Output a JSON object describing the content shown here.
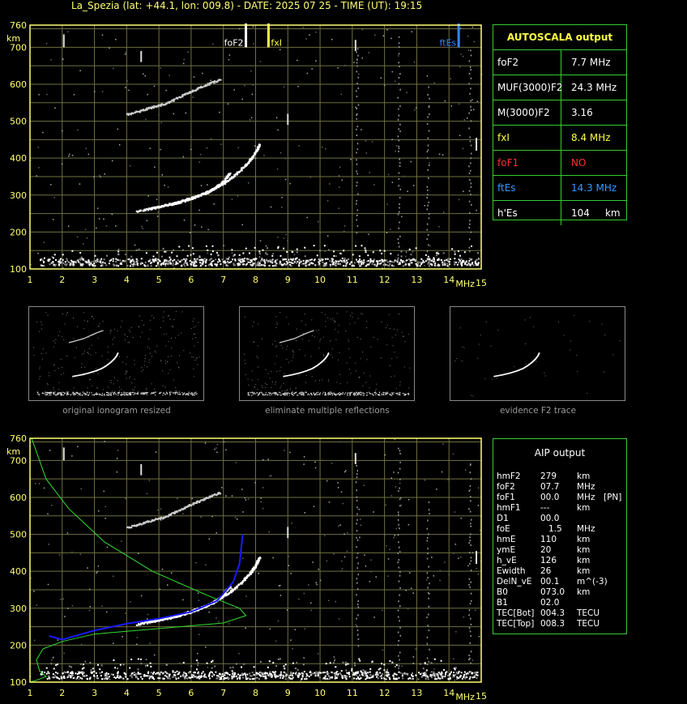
{
  "header": {
    "title": "La_Spezia (lat: +44.1, lon: 009.8) - DATE: 2025 07 25 - TIME (UT): 19:15"
  },
  "colors": {
    "axis": "#ffff70",
    "grid": "#6f6f40",
    "panel_border": "#33cc33",
    "foF2_marker": "#ffffff",
    "fxI_marker": "#ffff40",
    "ftEs_marker": "#3388ff",
    "red_text": "#ff3030",
    "blue_text": "#3399ff",
    "profile_green": "#33dd33",
    "profile_blue": "#1a1aff"
  },
  "chart_data": [
    {
      "type": "scatter",
      "name_id": "autoscala-ionogram",
      "xlabel": "MHz",
      "ylabel": "km",
      "xlim": [
        1,
        15
      ],
      "ylim": [
        100,
        760
      ],
      "xticks": [
        1,
        2,
        3,
        4,
        5,
        6,
        7,
        8,
        9,
        10,
        11,
        12,
        13,
        14,
        15
      ],
      "yticks": [
        100,
        200,
        300,
        400,
        500,
        600,
        700,
        760
      ],
      "grid": true,
      "markers": [
        {
          "label": "foF2",
          "x": 7.7,
          "color": "#ffffff"
        },
        {
          "label": "fxI",
          "x": 8.4,
          "color": "#ffff40"
        },
        {
          "label": "ftEs",
          "x": 14.3,
          "color": "#3388ff"
        }
      ],
      "traces": [
        {
          "name": "o-trace",
          "points": [
            [
              4.3,
              258
            ],
            [
              5.0,
              270
            ],
            [
              5.6,
              283
            ],
            [
              6.2,
              300
            ],
            [
              6.7,
              318
            ],
            [
              7.1,
              340
            ],
            [
              7.5,
              368
            ],
            [
              7.8,
              395
            ],
            [
              8.0,
              420
            ],
            [
              8.1,
              440
            ]
          ]
        },
        {
          "name": "x-trace",
          "points": [
            [
              4.7,
              265
            ],
            [
              5.4,
              277
            ],
            [
              6.0,
              292
            ],
            [
              6.5,
              310
            ],
            [
              6.9,
              332
            ],
            [
              7.2,
              362
            ]
          ]
        },
        {
          "name": "multiple-reflection",
          "points": [
            [
              4.0,
              520
            ],
            [
              4.6,
              535
            ],
            [
              5.2,
              550
            ],
            [
              5.8,
              575
            ],
            [
              6.3,
              595
            ],
            [
              6.9,
              615
            ]
          ]
        },
        {
          "name": "Es-layer",
          "points": [
            [
              1.3,
              120
            ],
            [
              3,
              122
            ],
            [
              5,
              120
            ],
            [
              7,
              121
            ],
            [
              9,
              121
            ],
            [
              11,
              122
            ],
            [
              12,
              120
            ],
            [
              14,
              125
            ],
            [
              14.9,
              123
            ]
          ]
        }
      ]
    },
    {
      "type": "scatter",
      "name_id": "aip-ionogram",
      "xlabel": "MHz",
      "ylabel": "km",
      "xlim": [
        1,
        15
      ],
      "ylim": [
        100,
        760
      ],
      "xticks": [
        1,
        2,
        3,
        4,
        5,
        6,
        7,
        8,
        9,
        10,
        11,
        12,
        13,
        14,
        15
      ],
      "yticks": [
        100,
        200,
        300,
        400,
        500,
        600,
        700,
        760
      ],
      "grid": true,
      "profiles": [
        {
          "name": "green-profile",
          "color": "#33dd33",
          "points": [
            [
              1.05,
              760
            ],
            [
              1.5,
              650
            ],
            [
              2.2,
              570
            ],
            [
              3.3,
              480
            ],
            [
              4.8,
              400
            ],
            [
              6.5,
              335
            ],
            [
              7.5,
              300
            ],
            [
              7.7,
              280
            ],
            [
              7.0,
              260
            ],
            [
              5.0,
              245
            ],
            [
              3.0,
              230
            ],
            [
              2.0,
              210
            ],
            [
              1.4,
              190
            ],
            [
              1.2,
              160
            ],
            [
              1.3,
              130
            ],
            [
              1.5,
              115
            ],
            [
              1.2,
              105
            ],
            [
              1.0,
              100
            ]
          ]
        },
        {
          "name": "blue-trace",
          "color": "#1a1aff",
          "points": [
            [
              1.6,
              225
            ],
            [
              2.0,
              215
            ],
            [
              3.0,
              240
            ],
            [
              4.0,
              258
            ],
            [
              5.0,
              272
            ],
            [
              6.0,
              290
            ],
            [
              6.8,
              320
            ],
            [
              7.3,
              370
            ],
            [
              7.5,
              420
            ],
            [
              7.6,
              500
            ]
          ]
        }
      ]
    }
  ],
  "autoscala": {
    "title": "AUTOSCALA output",
    "rows": [
      {
        "key": "foF2",
        "value": "7.7 MHz",
        "color": "#ffffff"
      },
      {
        "key": "MUF(3000)F2",
        "value": "24.3 MHz",
        "color": "#ffffff"
      },
      {
        "key": "M(3000)F2",
        "value": "3.16",
        "color": "#ffffff"
      },
      {
        "key": "fxI",
        "value": "8.4 MHz",
        "color": "#ffff40"
      },
      {
        "key": "foF1",
        "value": "NO",
        "color": "#ff3030"
      },
      {
        "key": "ftEs",
        "value": "14.3 MHz",
        "color": "#3399ff"
      },
      {
        "key": "h'Es",
        "value": "104     km",
        "color": "#ffffff"
      }
    ]
  },
  "thumbs": [
    {
      "caption": "original ionogram resized"
    },
    {
      "caption": "eliminate multiple reflections"
    },
    {
      "caption": "evidence F2 trace"
    }
  ],
  "aip": {
    "title": "AIP output",
    "rows": [
      {
        "key": "hmF2",
        "value": "279",
        "unit": "km",
        "extra": ""
      },
      {
        "key": "foF2",
        "value": "07.7",
        "unit": "MHz",
        "extra": ""
      },
      {
        "key": "foF1",
        "value": "00.0",
        "unit": "MHz",
        "extra": "[PN]"
      },
      {
        "key": "hmF1",
        "value": "---",
        "unit": "km",
        "extra": ""
      },
      {
        "key": "D1",
        "value": "00.0",
        "unit": "",
        "extra": ""
      },
      {
        "key": "foE",
        "value": "1.5",
        "unit": "MHz",
        "extra": ""
      },
      {
        "key": "hmE",
        "value": "110",
        "unit": "km",
        "extra": ""
      },
      {
        "key": "ymE",
        "value": "20",
        "unit": "km",
        "extra": ""
      },
      {
        "key": "h_vE",
        "value": "126",
        "unit": "km",
        "extra": ""
      },
      {
        "key": "Ewidth",
        "value": "26",
        "unit": "km",
        "extra": ""
      },
      {
        "key": "DelN_vE",
        "value": "00.1",
        "unit": "m^(-3)",
        "extra": ""
      },
      {
        "key": "B0",
        "value": "073.0",
        "unit": "km",
        "extra": ""
      },
      {
        "key": "B1",
        "value": "02.0",
        "unit": "",
        "extra": ""
      },
      {
        "key": "TEC[Bot]",
        "value": "004.3",
        "unit": "TECU",
        "extra": ""
      },
      {
        "key": "TEC[Top]",
        "value": "008.3",
        "unit": "TECU",
        "extra": ""
      }
    ]
  }
}
